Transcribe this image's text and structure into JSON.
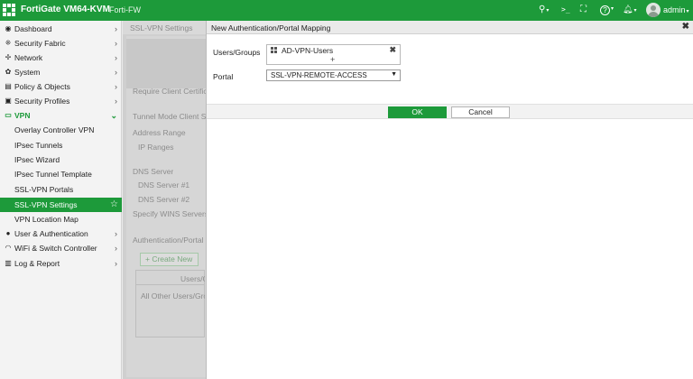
{
  "header": {
    "app_title": "FortiGate VM64-KVM",
    "hostname": "Forti-FW",
    "user": "admin",
    "icons": [
      "search-icon",
      "terminal-icon",
      "fullscreen-icon",
      "help-icon",
      "bell-icon"
    ],
    "glyphs": {
      "search": "⚲",
      "terminal": ">_",
      "fullscreen": "⛶",
      "help": "?",
      "bell": "🔔︎",
      "caret": "▾"
    }
  },
  "sidebar": {
    "items": [
      {
        "label": "Dashboard",
        "icon": "dashboard-icon",
        "glyph": "◉",
        "chevron": "›"
      },
      {
        "label": "Security Fabric",
        "icon": "fabric-icon",
        "glyph": "⁜",
        "chevron": "›"
      },
      {
        "label": "Network",
        "icon": "network-icon",
        "glyph": "✢",
        "chevron": "›"
      },
      {
        "label": "System",
        "icon": "gear-icon",
        "glyph": "✿",
        "chevron": "›"
      },
      {
        "label": "Policy & Objects",
        "icon": "policy-icon",
        "glyph": "▤",
        "chevron": "›"
      },
      {
        "label": "Security Profiles",
        "icon": "lock-icon",
        "glyph": "▣",
        "chevron": "›"
      },
      {
        "label": "VPN",
        "icon": "monitor-icon",
        "glyph": "▭",
        "chevron": "⌄"
      },
      {
        "label": "Overlay Controller VPN"
      },
      {
        "label": "IPsec Tunnels"
      },
      {
        "label": "IPsec Wizard"
      },
      {
        "label": "IPsec Tunnel Template"
      },
      {
        "label": "SSL-VPN Portals"
      },
      {
        "label": "SSL-VPN Settings",
        "star": "☆"
      },
      {
        "label": "VPN Location Map"
      },
      {
        "label": "User & Authentication",
        "icon": "user-icon",
        "glyph": "●",
        "chevron": "›"
      },
      {
        "label": "WiFi & Switch Controller",
        "icon": "wifi-icon",
        "glyph": "◠",
        "chevron": "›"
      },
      {
        "label": "Log & Report",
        "icon": "chart-icon",
        "glyph": "▥",
        "chevron": "›"
      }
    ]
  },
  "background_page": {
    "tab": "SSL-VPN Settings",
    "labels": {
      "require_client_cert": "Require Client Certific",
      "tunnel_mode": "Tunnel Mode Client Se",
      "address_range": "Address Range",
      "ip_ranges": "IP Ranges",
      "dns_server": "DNS Server",
      "dns1": "DNS Server #1",
      "dns2": "DNS Server #2",
      "wins": "Specify WINS Servers",
      "auth_portal": "Authentication/Portal",
      "users_col": "Users/C",
      "all_other": "All Other Users/Gro"
    },
    "create_new": "+ Create New"
  },
  "dialog": {
    "title": "New Authentication/Portal Mapping",
    "close_glyph": "✖",
    "users_label": "Users/Groups",
    "users_value": "AD-VPN-Users",
    "remove_glyph": "✖",
    "add_glyph": "+",
    "portal_label": "Portal",
    "portal_value": "SSL-VPN-REMOTE-ACCESS",
    "dropdown_glyph": "▼",
    "ok_label": "OK",
    "cancel_label": "Cancel"
  },
  "colors": {
    "brand_green": "#1d9a3a"
  }
}
